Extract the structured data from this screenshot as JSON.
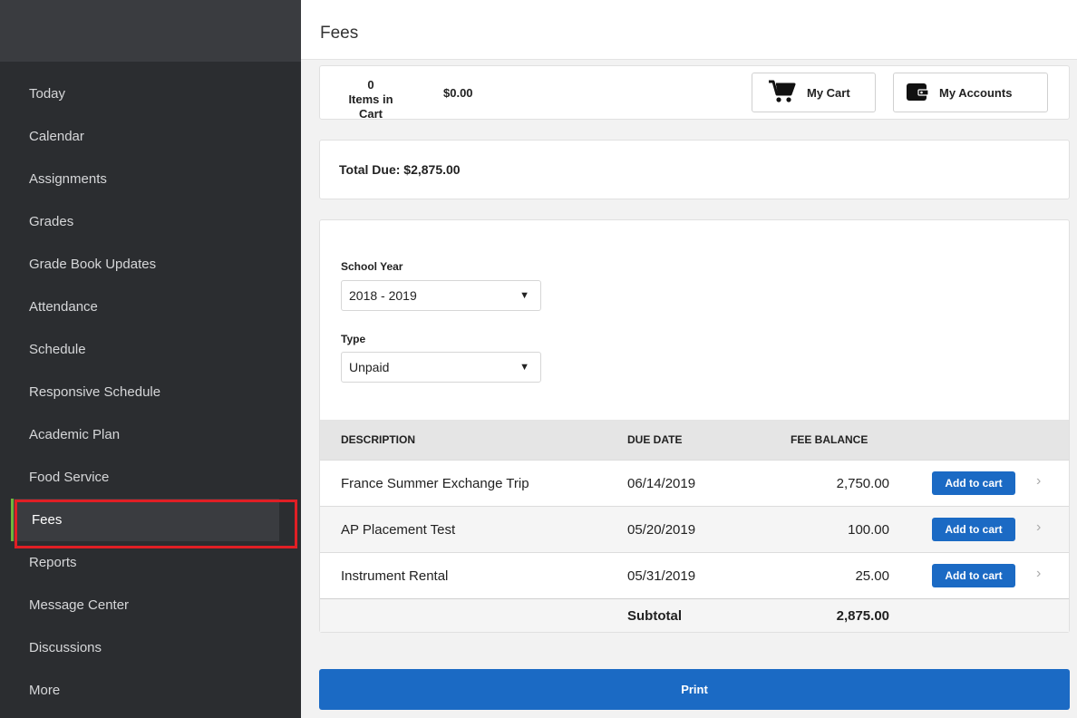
{
  "sidebar": {
    "items": [
      {
        "label": "Today"
      },
      {
        "label": "Calendar"
      },
      {
        "label": "Assignments"
      },
      {
        "label": "Grades"
      },
      {
        "label": "Grade Book Updates"
      },
      {
        "label": "Attendance"
      },
      {
        "label": "Schedule"
      },
      {
        "label": "Responsive Schedule"
      },
      {
        "label": "Academic Plan"
      },
      {
        "label": "Food Service"
      },
      {
        "label": "Fees",
        "active": true
      },
      {
        "label": "Reports"
      },
      {
        "label": "Message Center"
      },
      {
        "label": "Discussions"
      },
      {
        "label": "More"
      }
    ]
  },
  "header": {
    "title": "Fees"
  },
  "cart": {
    "count": "0",
    "count_label": "Items in Cart",
    "total": "$0.00",
    "my_cart_label": "My Cart",
    "my_accounts_label": "My Accounts"
  },
  "total_due": "Total Due: $2,875.00",
  "filters": {
    "school_year_label": "School Year",
    "school_year_value": "2018 - 2019",
    "type_label": "Type",
    "type_value": "Unpaid"
  },
  "table": {
    "headers": {
      "description": "DESCRIPTION",
      "due_date": "DUE DATE",
      "fee_balance": "FEE BALANCE"
    },
    "rows": [
      {
        "description": "France Summer Exchange Trip",
        "due_date": "06/14/2019",
        "balance": "2,750.00",
        "action": "Add to cart"
      },
      {
        "description": "AP Placement Test",
        "due_date": "05/20/2019",
        "balance": "100.00",
        "action": "Add to cart"
      },
      {
        "description": "Instrument Rental",
        "due_date": "05/31/2019",
        "balance": "25.00",
        "action": "Add to cart"
      }
    ],
    "subtotal_label": "Subtotal",
    "subtotal_value": "2,875.00"
  },
  "print_label": "Print",
  "colors": {
    "accent": "#1b6ac4",
    "sidebar": "#2b2d30",
    "highlight": "#e01f25",
    "active_marker": "#6fb53c"
  }
}
